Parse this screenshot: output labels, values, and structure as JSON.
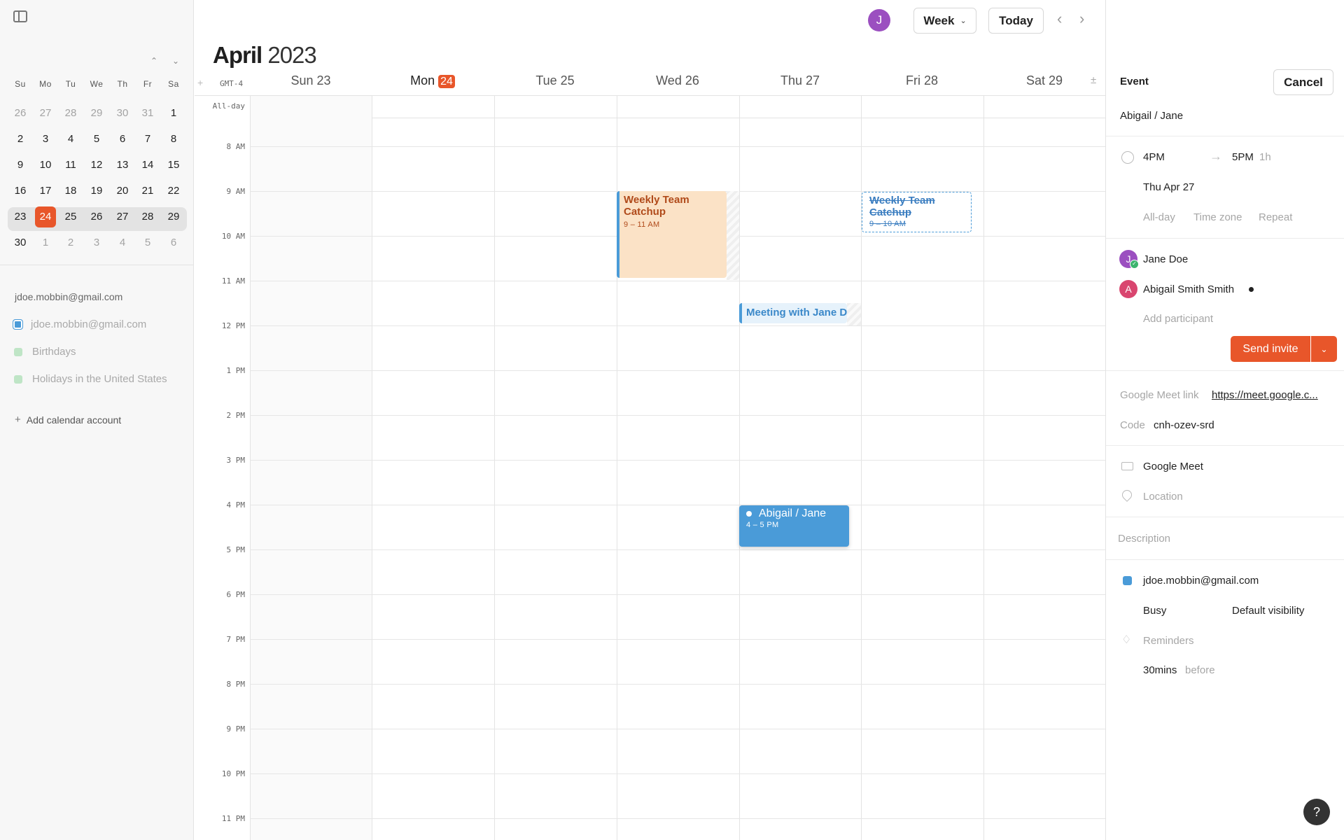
{
  "mini_calendar": {
    "weekdays": [
      "Su",
      "Mo",
      "Tu",
      "We",
      "Th",
      "Fr",
      "Sa"
    ],
    "weeks": [
      [
        "26",
        "27",
        "28",
        "29",
        "30",
        "31",
        "1"
      ],
      [
        "2",
        "3",
        "4",
        "5",
        "6",
        "7",
        "8"
      ],
      [
        "9",
        "10",
        "11",
        "12",
        "13",
        "14",
        "15"
      ],
      [
        "16",
        "17",
        "18",
        "19",
        "20",
        "21",
        "22"
      ],
      [
        "23",
        "24",
        "25",
        "26",
        "27",
        "28",
        "29"
      ],
      [
        "30",
        "1",
        "2",
        "3",
        "4",
        "5",
        "6"
      ]
    ],
    "today": "24"
  },
  "sidebar": {
    "account": "jdoe.mobbin@gmail.com",
    "calendars": [
      {
        "label": "jdoe.mobbin@gmail.com",
        "color": "#4a9bd8"
      },
      {
        "label": "Birthdays",
        "color": "#8fd49a"
      },
      {
        "label": "Holidays in the United States",
        "color": "#8fd49a"
      }
    ],
    "add_account": "Add calendar account"
  },
  "header": {
    "avatar": "J",
    "view": "Week",
    "today": "Today",
    "month": "April",
    "year": "2023"
  },
  "grid": {
    "timezone": "GMT-4",
    "allday": "All-day",
    "days": [
      {
        "label": "Sun 23"
      },
      {
        "label": "Mon",
        "badge": "24"
      },
      {
        "label": "Tue 25"
      },
      {
        "label": "Wed 26"
      },
      {
        "label": "Thu 27"
      },
      {
        "label": "Fri 28"
      },
      {
        "label": "Sat 29"
      }
    ],
    "hours": [
      "8 AM",
      "9 AM",
      "10 AM",
      "11 AM",
      "12 PM",
      "1 PM",
      "2 PM",
      "3 PM",
      "4 PM",
      "5 PM",
      "6 PM",
      "7 PM",
      "8 PM",
      "9 PM",
      "10 PM",
      "11 PM"
    ]
  },
  "events": {
    "wed_catchup": {
      "title": "Weekly Team Catchup",
      "time": "9 – 11 AM"
    },
    "fri_catchup": {
      "title": "Weekly Team Catchup",
      "time": "9 – 10 AM"
    },
    "thu_meeting": {
      "title": "Meeting with Jane D"
    },
    "thu_abigail": {
      "title": "Abigail / Jane",
      "time": "4 – 5 PM"
    }
  },
  "panel": {
    "heading": "Event",
    "cancel": "Cancel",
    "title": "Abigail / Jane",
    "start": "4PM",
    "end": "5PM",
    "duration": "1h",
    "date": "Thu Apr 27",
    "allday": "All-day",
    "timezone": "Time zone",
    "repeat": "Repeat",
    "participants": [
      {
        "initial": "J",
        "name": "Jane Doe",
        "color": "#9b4fc0"
      },
      {
        "initial": "A",
        "name": "Abigail Smith Smith",
        "color": "#d9466f"
      }
    ],
    "add_participant": "Add participant",
    "send_invite": "Send invite",
    "meet_label": "Google Meet link",
    "meet_link": "https://meet.google.c...",
    "code_label": "Code",
    "code": "cnh-ozev-srd",
    "conference": "Google Meet",
    "location": "Location",
    "description": "Description",
    "calendar": "jdoe.mobbin@gmail.com",
    "busy": "Busy",
    "visibility": "Default visibility",
    "reminders": "Reminders",
    "reminder_value": "30mins",
    "reminder_suffix": "before",
    "help": "?"
  }
}
